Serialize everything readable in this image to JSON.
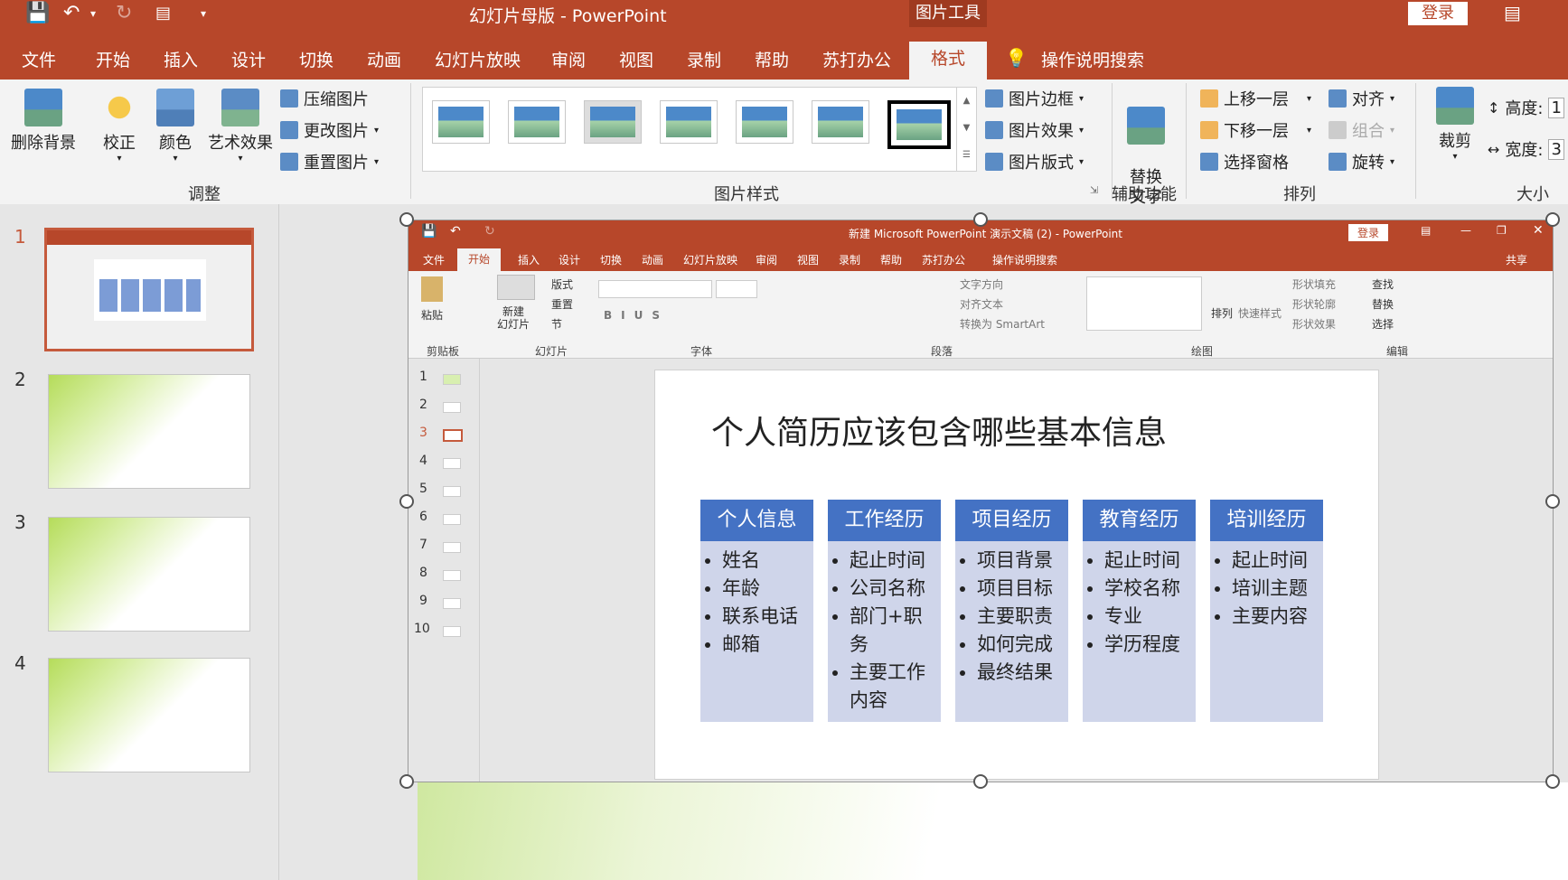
{
  "app": {
    "title": "幻灯片母版  -  PowerPoint",
    "context_tab_group": "图片工具",
    "login_label": "登录",
    "accent_color": "#b7472a"
  },
  "tabs": [
    "文件",
    "开始",
    "插入",
    "设计",
    "切换",
    "动画",
    "幻灯片放映",
    "审阅",
    "视图",
    "录制",
    "帮助",
    "苏打办公"
  ],
  "active_tab": "格式",
  "tell_me": "操作说明搜索",
  "ribbon": {
    "adjust": {
      "remove_bg": "删除背景",
      "correct": "校正",
      "color": "颜色",
      "art_effect": "艺术效果",
      "compress": "压缩图片",
      "change": "更改图片",
      "reset": "重置图片",
      "label": "调整"
    },
    "styles": {
      "border": "图片边框",
      "effect": "图片效果",
      "layout": "图片版式",
      "label": "图片样式"
    },
    "access": {
      "alt_text": "替换\n文字",
      "label": "辅助功能"
    },
    "arrange": {
      "bring_forward": "上移一层",
      "send_backward": "下移一层",
      "selection_pane": "选择窗格",
      "align": "对齐",
      "group": "组合",
      "rotate": "旋转",
      "label": "排列"
    },
    "size": {
      "crop": "裁剪",
      "height": "高度:",
      "height_val": "1",
      "width": "宽度:",
      "width_val": "3",
      "label": "大小"
    }
  },
  "slides": [
    {
      "num": "1",
      "selected": true
    },
    {
      "num": "2"
    },
    {
      "num": "3"
    },
    {
      "num": "4"
    }
  ],
  "inner": {
    "title": "新建 Microsoft PowerPoint 演示文稿 (2)  -  PowerPoint",
    "login": "登录",
    "share": "共享",
    "tabs": [
      "文件",
      "开始",
      "插入",
      "设计",
      "切换",
      "动画",
      "幻灯片放映",
      "审阅",
      "视图",
      "录制",
      "帮助",
      "苏打办公"
    ],
    "active_tab": "开始",
    "tell_me": "操作说明搜索",
    "ribbon": {
      "paste": "粘贴",
      "clipboard": "剪贴板",
      "new_slide": "新建\n幻灯片",
      "layout": "版式",
      "reset": "重置",
      "section": "节",
      "slides_grp": "幻灯片",
      "font_grp": "字体",
      "para_grp": "段落",
      "text_dir": "文字方向",
      "align_text": "对齐文本",
      "smartart": "转换为 SmartArt",
      "arrange": "排列",
      "quick_style": "快速样式",
      "shape_fill": "形状填充",
      "shape_outline": "形状轮廓",
      "shape_effect": "形状效果",
      "drawing_grp": "绘图",
      "find": "查找",
      "replace": "替换",
      "select": "选择",
      "edit_grp": "编辑"
    },
    "slide_numbers": [
      "1",
      "2",
      "3",
      "4",
      "5",
      "6",
      "7",
      "8",
      "9",
      "10"
    ],
    "slide": {
      "title": "个人简历应该包含哪些基本信息",
      "columns": [
        {
          "header": "个人信息",
          "items": [
            "姓名",
            "年龄",
            "联系电话",
            "邮箱"
          ]
        },
        {
          "header": "工作经历",
          "items": [
            "起止时间",
            "公司名称",
            "部门+职务",
            "主要工作内容"
          ]
        },
        {
          "header": "项目经历",
          "items": [
            "项目背景",
            "项目目标",
            "主要职责",
            "如何完成",
            "最终结果"
          ]
        },
        {
          "header": "教育经历",
          "items": [
            "起止时间",
            "学校名称",
            "专业",
            "学历程度"
          ]
        },
        {
          "header": "培训经历",
          "items": [
            "起止时间",
            "培训主题",
            "主要内容"
          ]
        }
      ]
    }
  }
}
